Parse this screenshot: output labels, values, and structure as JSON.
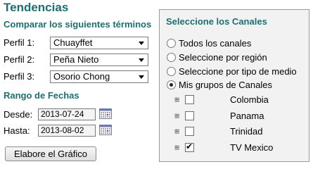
{
  "page": {
    "title": "Tendencias"
  },
  "terms": {
    "heading": "Comparar los siguientes términos",
    "profiles": [
      {
        "label": "Perfil 1:",
        "value": "Chuayffet"
      },
      {
        "label": "Perfil 2:",
        "value": "Peña Nieto"
      },
      {
        "label": "Perfil 3:",
        "value": "Osorio Chong"
      }
    ]
  },
  "dates": {
    "heading": "Rango de Fechas",
    "from_label": "Desde:",
    "from_value": "2013-07-24",
    "to_label": "Hasta:",
    "to_value": "2013-08-02"
  },
  "actions": {
    "build_label": "Elabore el Gráfico"
  },
  "channels": {
    "heading": "Seleccione los Canales",
    "options": [
      {
        "label": "Todos los canales",
        "selected": false
      },
      {
        "label": "Seleccione por región",
        "selected": false
      },
      {
        "label": "Seleccione por tipo de medio",
        "selected": false
      },
      {
        "label": "Mis grupos de Canales",
        "selected": true
      }
    ],
    "groups": [
      {
        "label": "Colombia",
        "checked": false
      },
      {
        "label": "Panama",
        "checked": false
      },
      {
        "label": "Trinidad",
        "checked": false
      },
      {
        "label": "TV Mexico",
        "checked": true
      }
    ]
  }
}
